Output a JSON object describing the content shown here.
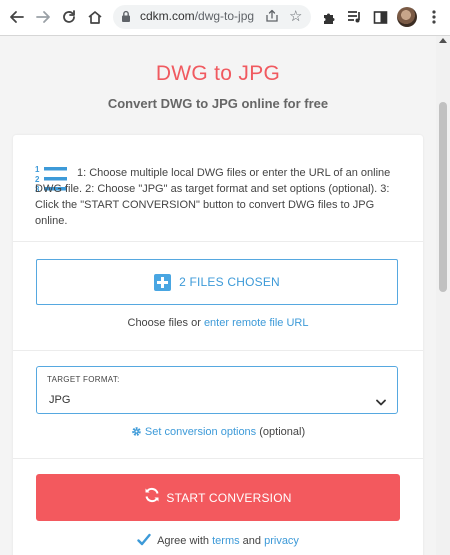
{
  "browser": {
    "url_host": "cdkm.com",
    "url_path": "/dwg-to-jpg"
  },
  "page": {
    "title": "DWG to JPG",
    "subtitle": "Convert DWG to JPG online for free"
  },
  "instructions": {
    "text": "1: Choose multiple local DWG files or enter the URL of an online DWG file. 2: Choose \"JPG\" as target format and set options (optional). 3: Click the \"START CONVERSION\" button to convert DWG files to JPG online."
  },
  "upload": {
    "button_label": "2 FILES CHOSEN",
    "choose_prefix": "Choose files or",
    "remote_link": "enter remote file URL"
  },
  "format": {
    "label": "TARGET FORMAT:",
    "selected": "JPG",
    "options_link": "Set conversion options",
    "options_suffix": "(optional)"
  },
  "convert": {
    "button_label": "START CONVERSION",
    "agree_prefix": "Agree with",
    "terms_link": "terms",
    "and_text": "and",
    "privacy_link": "privacy",
    "agreed": true
  },
  "colors": {
    "accent_red": "#f3595e",
    "title_red": "#f05a60",
    "link_blue": "#3d9ad8"
  }
}
